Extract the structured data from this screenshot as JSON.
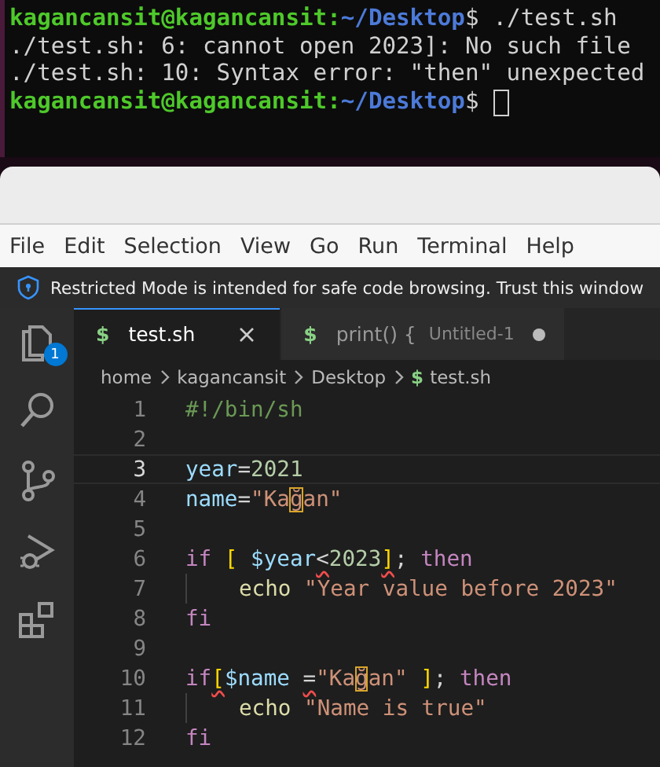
{
  "terminal": {
    "lines": [
      {
        "kind": "prompt",
        "user": "kagancansit@kagancansit:",
        "path": "~/Desktop",
        "symbol": "$",
        "command": "./test.sh",
        "cursor": false
      },
      {
        "kind": "output",
        "text": "./test.sh: 6: cannot open 2023]: No such file"
      },
      {
        "kind": "output",
        "text": "./test.sh: 10: Syntax error: \"then\" unexpected"
      },
      {
        "kind": "prompt",
        "user": "kagancansit@kagancansit:",
        "path": "~/Desktop",
        "symbol": "$",
        "cursor": true
      }
    ]
  },
  "menu": [
    "File",
    "Edit",
    "Selection",
    "View",
    "Go",
    "Run",
    "Terminal",
    "Help"
  ],
  "banner": {
    "text": "Restricted Mode is intended for safe code browsing. Trust this window"
  },
  "activity_bar": [
    {
      "kind": "explorer",
      "badge": "1"
    },
    {
      "kind": "search"
    },
    {
      "kind": "source_control"
    },
    {
      "kind": "run_debug"
    },
    {
      "kind": "extensions"
    }
  ],
  "tabs": [
    {
      "icon": "$",
      "label": "test.sh",
      "selected": true,
      "modified": false
    },
    {
      "icon": "$",
      "label": "print() {",
      "description": "Untitled-1",
      "selected": false,
      "modified": true
    }
  ],
  "breadcrumb": [
    {
      "label": "home"
    },
    {
      "label": "kagancansit"
    },
    {
      "label": "Desktop"
    },
    {
      "label": "test.sh",
      "icon": "$"
    }
  ],
  "code": [
    {
      "number": "1",
      "current": false,
      "indented": false,
      "tokens": [
        {
          "text": "#!/bin/sh",
          "kind": "comment",
          "error": false
        }
      ]
    },
    {
      "number": "2",
      "current": false
    },
    {
      "number": "3",
      "current": true,
      "indented": false,
      "tokens": [
        {
          "text": "year",
          "kind": "variable",
          "error": false
        },
        {
          "text": "=",
          "kind": "operator",
          "error": false
        },
        {
          "text": "2021",
          "kind": "number",
          "error": false
        }
      ]
    },
    {
      "number": "4",
      "current": false,
      "indented": false,
      "tokens": [
        {
          "text": "name",
          "kind": "variable",
          "error": false
        },
        {
          "text": "=",
          "kind": "operator",
          "error": false
        },
        {
          "text": "\"Ka",
          "kind": "string",
          "error": false
        },
        {
          "text": "ğ",
          "kind": "unicode",
          "error": false
        },
        {
          "text": "an\"",
          "kind": "string",
          "error": false
        }
      ]
    },
    {
      "number": "5",
      "current": false
    },
    {
      "number": "6",
      "current": false,
      "indented": false,
      "tokens": [
        {
          "text": "if ",
          "kind": "keyword",
          "error": false
        },
        {
          "text": "[ ",
          "kind": "bracket",
          "error": false
        },
        {
          "text": "$year",
          "kind": "variable",
          "error": false
        },
        {
          "text": "<",
          "kind": "operator",
          "error": true
        },
        {
          "text": "2023",
          "kind": "number",
          "error": false
        },
        {
          "text": "]",
          "kind": "bracket",
          "error": true
        },
        {
          "text": "; ",
          "kind": "plain",
          "error": false
        },
        {
          "text": "then",
          "kind": "keyword",
          "error": false
        }
      ]
    },
    {
      "number": "7",
      "current": false,
      "indented": true,
      "tokens": [
        {
          "text": "echo ",
          "kind": "command",
          "error": false
        },
        {
          "text": "\"Year value before 2023\"",
          "kind": "string",
          "error": false
        }
      ]
    },
    {
      "number": "8",
      "current": false,
      "indented": false,
      "tokens": [
        {
          "text": "fi",
          "kind": "keyword",
          "error": false
        }
      ]
    },
    {
      "number": "9",
      "current": false
    },
    {
      "number": "10",
      "current": false,
      "indented": false,
      "tokens": [
        {
          "text": "if",
          "kind": "keyword",
          "error": false
        },
        {
          "text": "[",
          "kind": "bracket",
          "error": true
        },
        {
          "text": "$name ",
          "kind": "variable",
          "error": false
        },
        {
          "text": "=",
          "kind": "operator",
          "error": true
        },
        {
          "text": "\"Ka",
          "kind": "string",
          "error": false
        },
        {
          "text": "ğ",
          "kind": "unicode",
          "error": false
        },
        {
          "text": "an\" ",
          "kind": "string",
          "error": false
        },
        {
          "text": "]",
          "kind": "bracket",
          "error": false
        },
        {
          "text": "; ",
          "kind": "plain",
          "error": false
        },
        {
          "text": "then",
          "kind": "keyword",
          "error": false
        }
      ]
    },
    {
      "number": "11",
      "current": false,
      "indented": true,
      "tokens": [
        {
          "text": "echo ",
          "kind": "command",
          "error": false
        },
        {
          "text": "\"Name is true\"",
          "kind": "string",
          "error": false
        }
      ]
    },
    {
      "number": "12",
      "current": false,
      "indented": false,
      "tokens": [
        {
          "text": "fi",
          "kind": "keyword",
          "error": false
        }
      ]
    }
  ]
}
